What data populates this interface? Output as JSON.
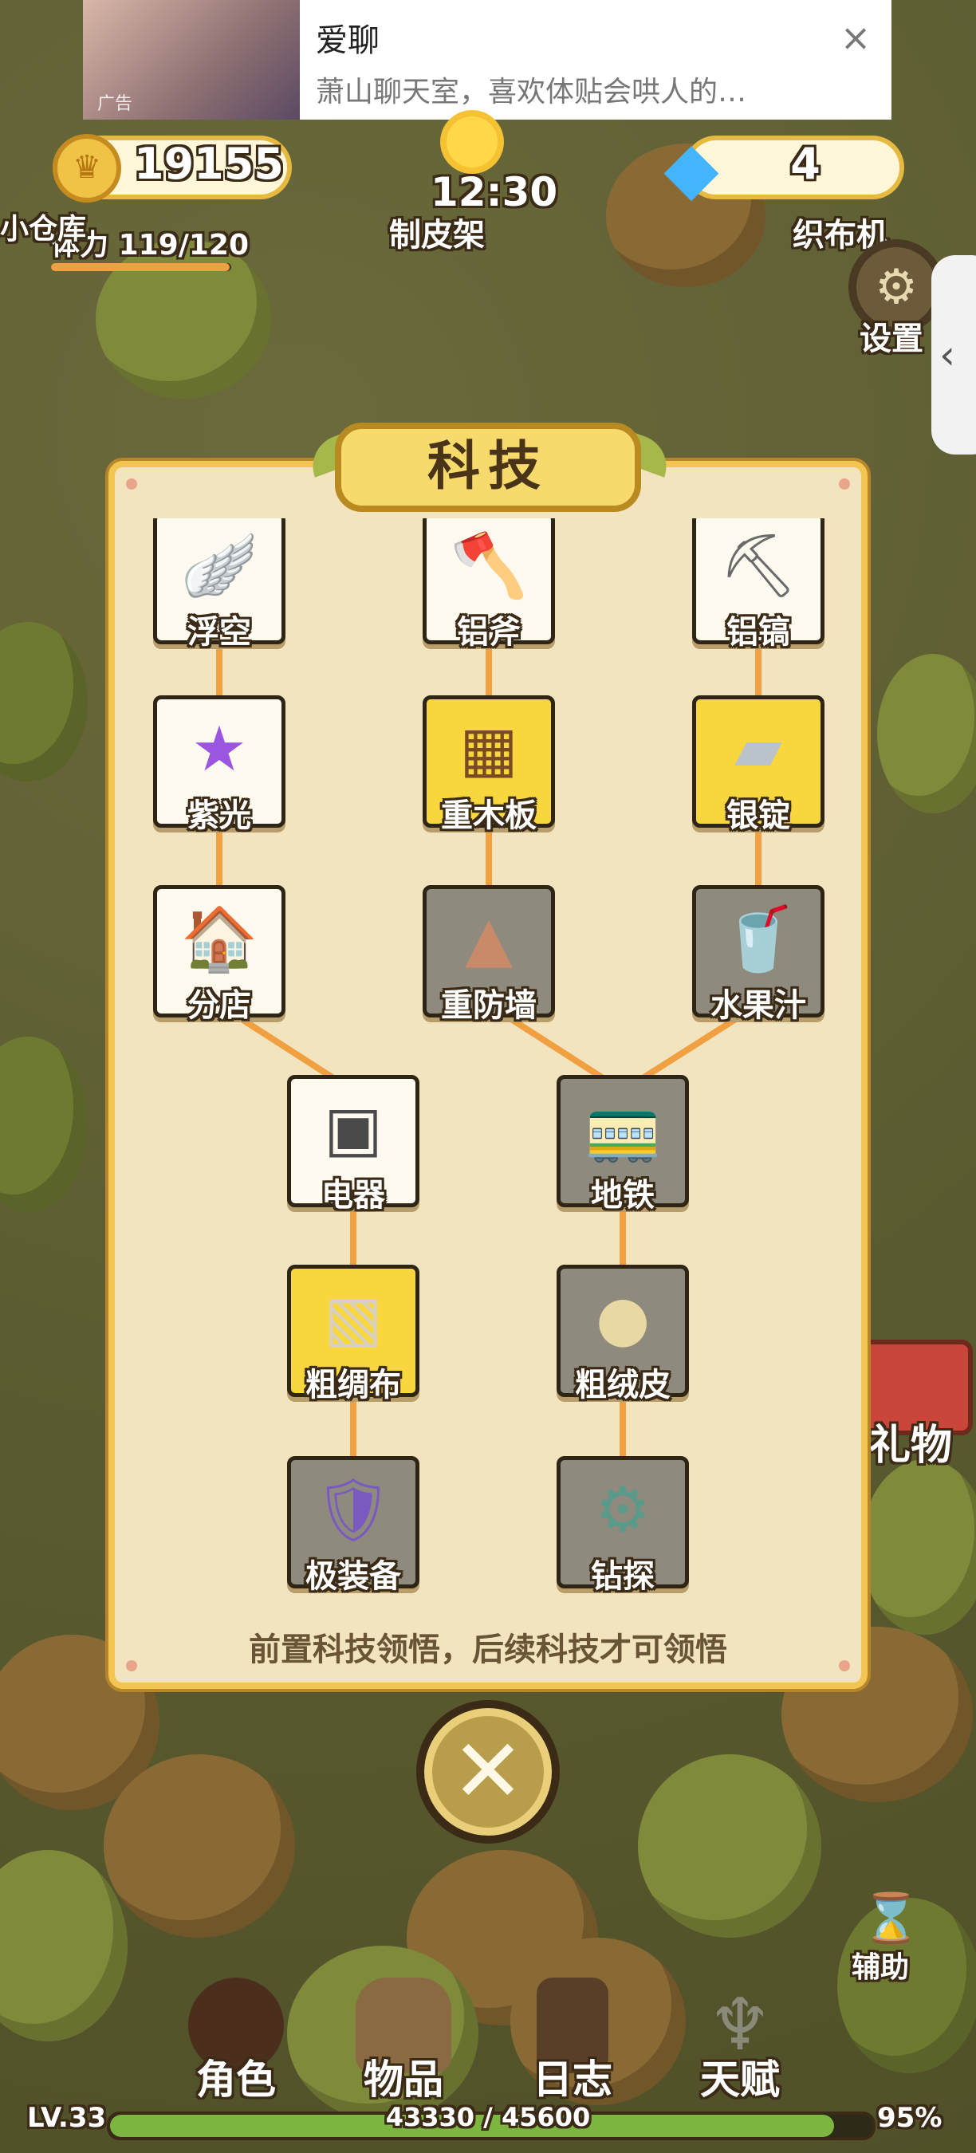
{
  "ad": {
    "title": "爱聊",
    "desc": "萧山聊天室，喜欢体贴会哄人的…",
    "tag": "广告",
    "close_icon": "×"
  },
  "hud": {
    "coins": "19155",
    "gems": "4",
    "clock": "12:30",
    "stamina_label": "体力",
    "stamina": "119/120",
    "stamina_ratio": 0.99
  },
  "map_labels": {
    "tanner": "制皮架",
    "loom": "织布机",
    "warehouse": "小仓库",
    "settings": "设置",
    "gift": "礼物"
  },
  "panel": {
    "title": "科技",
    "hint": "前置科技领悟，后续科技才可领悟",
    "nodes": [
      {
        "label": "浮空",
        "state": "white",
        "icon": "wing-icon",
        "glyph": "🪽"
      },
      {
        "label": "铝斧",
        "state": "white",
        "icon": "axe-icon",
        "glyph": "🪓"
      },
      {
        "label": "铝镐",
        "state": "white",
        "icon": "pickaxe-icon",
        "glyph": "⛏"
      },
      {
        "label": "紫光",
        "state": "white",
        "icon": "purple-star-icon",
        "glyph": "★"
      },
      {
        "label": "重木板",
        "state": "yellow",
        "icon": "wooden-crate-icon",
        "glyph": "▦"
      },
      {
        "label": "银锭",
        "state": "yellow",
        "icon": "silver-ingot-icon",
        "glyph": "▰"
      },
      {
        "label": "分店",
        "state": "white",
        "icon": "shop-icon",
        "glyph": "🏠"
      },
      {
        "label": "重防墙",
        "state": "gray",
        "icon": "spike-wall-icon",
        "glyph": "▲"
      },
      {
        "label": "水果汁",
        "state": "gray",
        "icon": "juice-icon",
        "glyph": "🥤"
      },
      {
        "label": "电器",
        "state": "white",
        "icon": "appliance-icon",
        "glyph": "▣"
      },
      {
        "label": "地铁",
        "state": "gray",
        "icon": "subway-icon",
        "glyph": "🚃"
      },
      {
        "label": "粗绸布",
        "state": "yellow",
        "icon": "silk-cloth-icon",
        "glyph": "▧"
      },
      {
        "label": "粗绒皮",
        "state": "gray",
        "icon": "fur-icon",
        "glyph": "●"
      },
      {
        "label": "极装备",
        "state": "gray",
        "icon": "equipment-icon",
        "glyph": "🛡"
      },
      {
        "label": "钻探",
        "state": "gray",
        "icon": "drill-icon",
        "glyph": "⚙"
      }
    ]
  },
  "close_glyph": "✕",
  "helper": "辅助",
  "nav": [
    {
      "label": "角色",
      "icon": "character-icon"
    },
    {
      "label": "物品",
      "icon": "bag-icon"
    },
    {
      "label": "日志",
      "icon": "journal-icon"
    },
    {
      "label": "天赋",
      "icon": "talent-icon"
    }
  ],
  "footer": {
    "level": "LV.33",
    "xp": "43330 / 45600",
    "pct": "95%",
    "xp_ratio": 0.95
  },
  "colors": {
    "panel_bg": "#f2e4bf",
    "panel_border": "#f3c552",
    "node_yellow": "#f7d63e",
    "node_gray": "#8e8a7d",
    "link": "#f0a040"
  }
}
